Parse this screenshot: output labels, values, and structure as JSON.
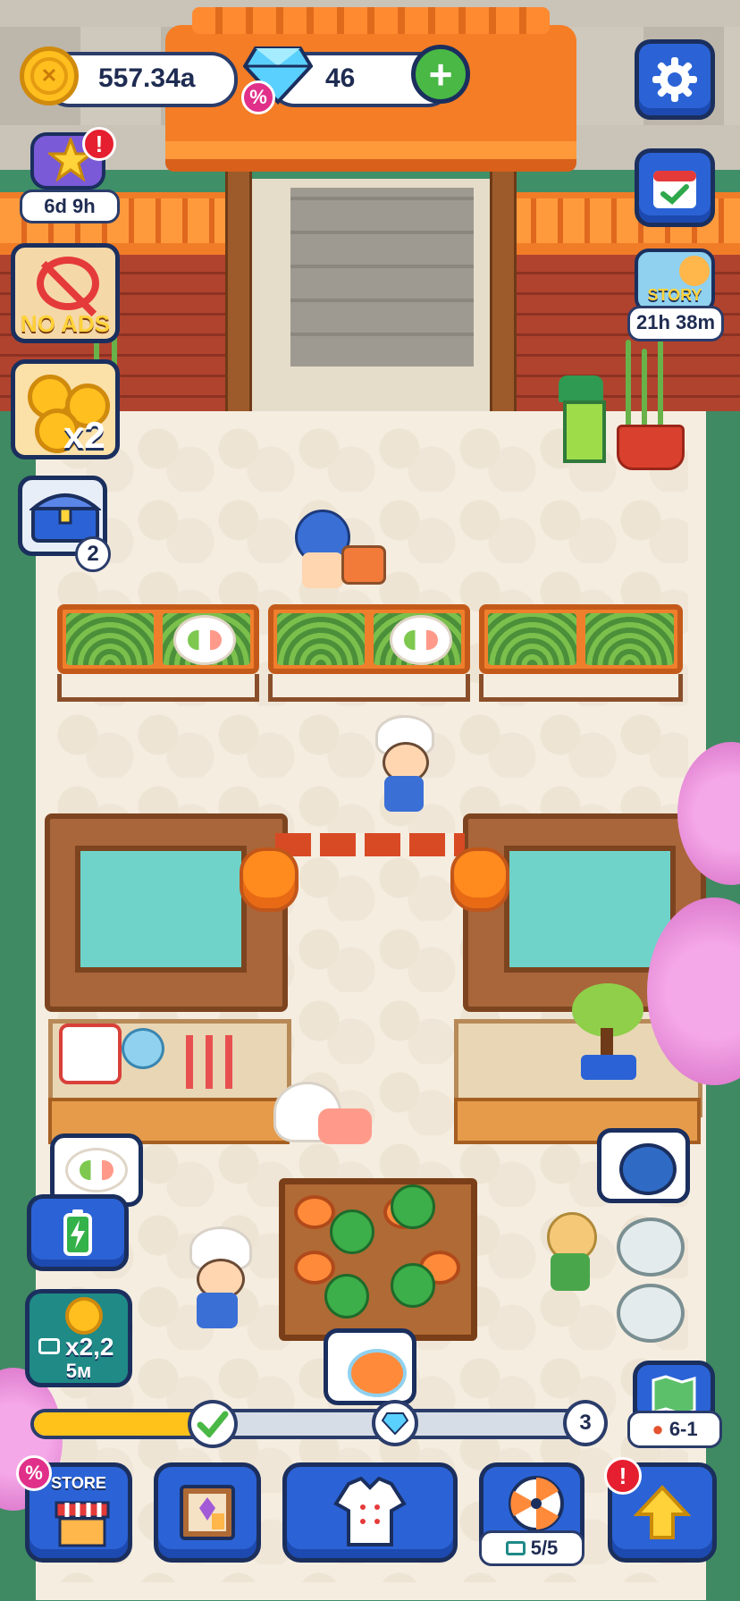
{
  "hud": {
    "coins": "557.34a",
    "gems": "46",
    "gem_discount_badge": "%"
  },
  "left_panel": {
    "event_timer": "6d 9h",
    "no_ads_label": "NO ADS",
    "coins_x2_label": "x2",
    "chest_count": "2",
    "ad_boost_multiplier": "x2,2",
    "ad_boost_duration": "5м"
  },
  "right_panel": {
    "story_label": "STORY",
    "story_timer": "21h 38m",
    "level_label": "6-1"
  },
  "progress": {
    "fill_fraction": 0.33,
    "end_badge": "3"
  },
  "bottom_bar": {
    "store_label": "STORE",
    "store_discount_badge": "%",
    "wheel_count": "5/5",
    "alert_badge": "!"
  },
  "colors": {
    "accent_blue": "#2b63d6",
    "outline": "#1b2f5e",
    "coin_gold": "#ffbf1f",
    "progress_fill": "#ffc21a",
    "alert_red": "#e51f2f"
  }
}
